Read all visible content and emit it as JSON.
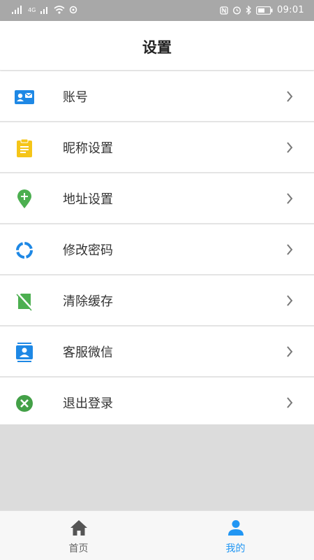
{
  "status_bar": {
    "time": "09:01",
    "signal_label": "4G"
  },
  "header": {
    "title": "设置"
  },
  "settings": {
    "items": [
      {
        "label": "账号",
        "icon": "account-card-icon",
        "color": "#1e88e5"
      },
      {
        "label": "昵称设置",
        "icon": "clipboard-icon",
        "color": "#f5c518"
      },
      {
        "label": "地址设置",
        "icon": "location-pin-icon",
        "color": "#4caf50"
      },
      {
        "label": "修改密码",
        "icon": "ring-icon",
        "color": "#1e88e5"
      },
      {
        "label": "清除缓存",
        "icon": "sd-card-off-icon",
        "color": "#4caf50"
      },
      {
        "label": "客服微信",
        "icon": "contact-card-icon",
        "color": "#1e88e5"
      },
      {
        "label": "退出登录",
        "icon": "close-circle-icon",
        "color": "#43a047"
      }
    ]
  },
  "tabbar": {
    "tabs": [
      {
        "label": "首页",
        "icon": "home-icon",
        "active": false
      },
      {
        "label": "我的",
        "icon": "person-icon",
        "active": true
      }
    ],
    "active_color": "#2196f3",
    "inactive_color": "#666666"
  }
}
